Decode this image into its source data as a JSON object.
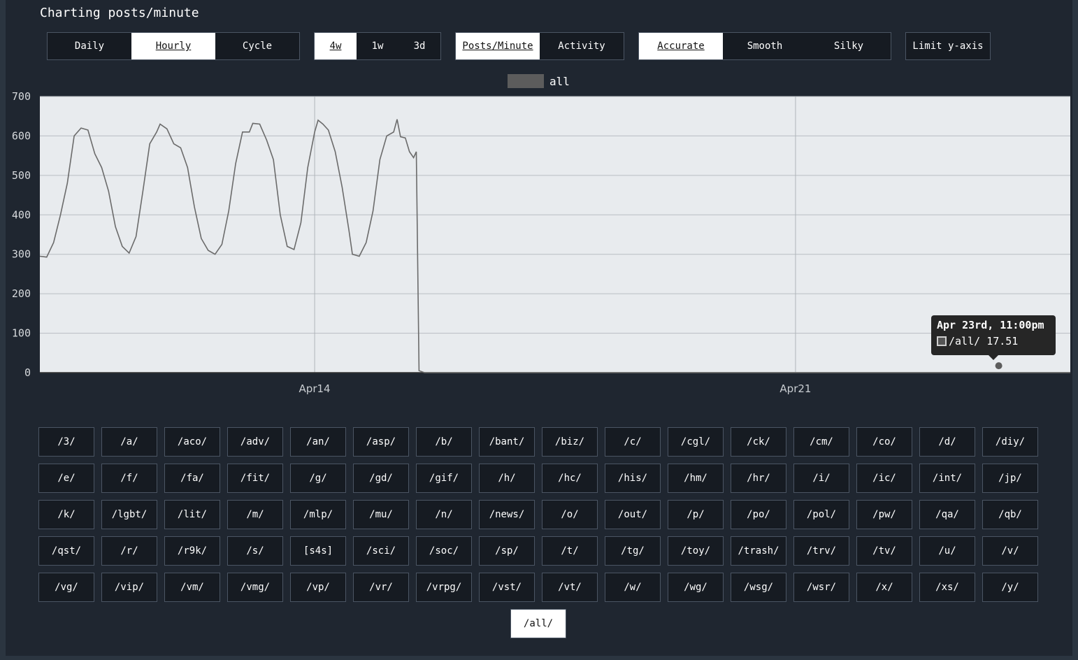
{
  "title": "Charting posts/minute",
  "mode_buttons": [
    {
      "label": "Daily",
      "active": false
    },
    {
      "label": "Hourly",
      "active": true
    },
    {
      "label": "Cycle",
      "active": false
    }
  ],
  "range_buttons": [
    {
      "label": "4w",
      "active": true
    },
    {
      "label": "1w",
      "active": false
    },
    {
      "label": "3d",
      "active": false
    }
  ],
  "metric_buttons": [
    {
      "label": "Posts/Minute",
      "active": true
    },
    {
      "label": "Activity",
      "active": false
    }
  ],
  "smooth_buttons": [
    {
      "label": "Accurate",
      "active": true
    },
    {
      "label": "Smooth",
      "active": false
    },
    {
      "label": "Silky",
      "active": false
    }
  ],
  "limit_button": "Limit y-axis",
  "legend": {
    "label": "all",
    "color": "#5c5c5c"
  },
  "tooltip": {
    "title": "Apr 23rd, 11:00pm",
    "series": "/all/",
    "value": "17.51"
  },
  "chart_data": {
    "type": "line",
    "ylim": [
      0,
      700
    ],
    "yticks": [
      "0",
      "100",
      "200",
      "300",
      "400",
      "500",
      "600",
      "700"
    ],
    "xticks": [
      {
        "label": "Apr14",
        "day": 14
      },
      {
        "label": "Apr21",
        "day": 21
      }
    ],
    "xlim_days": [
      10.0,
      25.0
    ],
    "grid": true,
    "series": [
      {
        "name": "all",
        "color": "#6b6b6b",
        "points": [
          [
            10.0,
            295
          ],
          [
            10.1,
            293
          ],
          [
            10.2,
            330
          ],
          [
            10.3,
            400
          ],
          [
            10.4,
            480
          ],
          [
            10.5,
            600
          ],
          [
            10.6,
            620
          ],
          [
            10.7,
            615
          ],
          [
            10.8,
            555
          ],
          [
            10.9,
            520
          ],
          [
            11.0,
            460
          ],
          [
            11.1,
            370
          ],
          [
            11.2,
            320
          ],
          [
            11.3,
            303
          ],
          [
            11.4,
            345
          ],
          [
            11.5,
            460
          ],
          [
            11.6,
            580
          ],
          [
            11.7,
            610
          ],
          [
            11.75,
            630
          ],
          [
            11.85,
            618
          ],
          [
            11.95,
            580
          ],
          [
            12.05,
            570
          ],
          [
            12.15,
            520
          ],
          [
            12.25,
            420
          ],
          [
            12.35,
            340
          ],
          [
            12.45,
            310
          ],
          [
            12.55,
            300
          ],
          [
            12.65,
            325
          ],
          [
            12.75,
            410
          ],
          [
            12.85,
            530
          ],
          [
            12.95,
            610
          ],
          [
            13.05,
            610
          ],
          [
            13.1,
            632
          ],
          [
            13.2,
            630
          ],
          [
            13.3,
            590
          ],
          [
            13.4,
            540
          ],
          [
            13.5,
            400
          ],
          [
            13.6,
            320
          ],
          [
            13.7,
            312
          ],
          [
            13.8,
            380
          ],
          [
            13.9,
            520
          ],
          [
            14.0,
            610
          ],
          [
            14.05,
            640
          ],
          [
            14.12,
            630
          ],
          [
            14.2,
            615
          ],
          [
            14.3,
            560
          ],
          [
            14.4,
            470
          ],
          [
            14.5,
            360
          ],
          [
            14.55,
            300
          ],
          [
            14.65,
            295
          ],
          [
            14.75,
            330
          ],
          [
            14.85,
            410
          ],
          [
            14.95,
            540
          ],
          [
            15.05,
            600
          ],
          [
            15.15,
            610
          ],
          [
            15.2,
            642
          ],
          [
            15.25,
            598
          ],
          [
            15.32,
            595
          ],
          [
            15.38,
            560
          ],
          [
            15.44,
            545
          ],
          [
            15.48,
            560
          ],
          [
            15.52,
            5
          ],
          [
            15.6,
            0
          ],
          [
            25.0,
            0
          ]
        ]
      }
    ],
    "highlight_point": {
      "day": 23.958,
      "value": 17.51
    }
  },
  "boards": [
    "/3/",
    "/a/",
    "/aco/",
    "/adv/",
    "/an/",
    "/asp/",
    "/b/",
    "/bant/",
    "/biz/",
    "/c/",
    "/cgl/",
    "/ck/",
    "/cm/",
    "/co/",
    "/d/",
    "/diy/",
    "/e/",
    "/f/",
    "/fa/",
    "/fit/",
    "/g/",
    "/gd/",
    "/gif/",
    "/h/",
    "/hc/",
    "/his/",
    "/hm/",
    "/hr/",
    "/i/",
    "/ic/",
    "/int/",
    "/jp/",
    "/k/",
    "/lgbt/",
    "/lit/",
    "/m/",
    "/mlp/",
    "/mu/",
    "/n/",
    "/news/",
    "/o/",
    "/out/",
    "/p/",
    "/po/",
    "/pol/",
    "/pw/",
    "/qa/",
    "/qb/",
    "/qst/",
    "/r/",
    "/r9k/",
    "/s/",
    "[s4s]",
    "/sci/",
    "/soc/",
    "/sp/",
    "/t/",
    "/tg/",
    "/toy/",
    "/trash/",
    "/trv/",
    "/tv/",
    "/u/",
    "/v/",
    "/vg/",
    "/vip/",
    "/vm/",
    "/vmg/",
    "/vp/",
    "/vr/",
    "/vrpg/",
    "/vst/",
    "/vt/",
    "/w/",
    "/wg/",
    "/wsg/",
    "/wsr/",
    "/x/",
    "/xs/",
    "/y/"
  ],
  "board_all": "/all/"
}
